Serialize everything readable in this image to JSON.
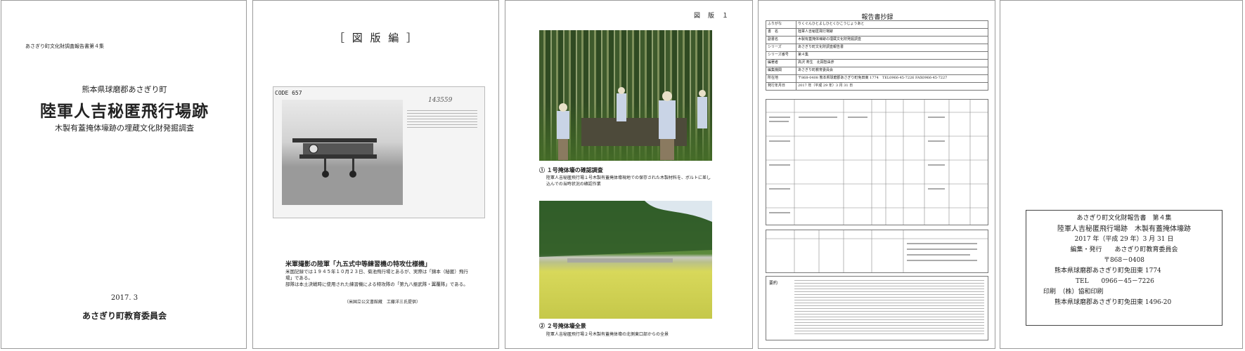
{
  "page1": {
    "series": "あさぎり町文化財調査報告書第４集",
    "location": "熊本県球磨郡あさぎり町",
    "title": "陸軍人吉秘匿飛行場跡",
    "subtitle": "木製有蓋掩体壕跡の埋蔵文化財発掘調査",
    "date": "2017. 3",
    "publisher": "あさぎり町教育委員会"
  },
  "page2": {
    "heading": "［ 図 版 編 ］",
    "photo_code": "CODE 657",
    "photo_stamp": "143559",
    "caption_title": "米軍撮影の陸軍「九五式中等練習機の特攻仕様機」",
    "caption_body": "米国記録では１９４５年１０月２３日、菊池飛行場とあるが、実際は「錦本（秘匿）飛行場」である。",
    "caption_body2": "部隊は本土決戦時に使用された練習機による特攻隊の「第九八振武隊・翼覆隊」である。",
    "source": "（米国立公文書館蔵　工藤洋三氏提供）"
  },
  "page3": {
    "plate": "図　版　１",
    "caption1_title": "① １号掩体壕の確認調査",
    "caption1_body": "陸軍人吉秘匿飛行場１号木製有蓋掩体壕現地での保存された木製材料を、ボルトに差し込んでの当時状況の確認作業",
    "caption2_title": "② ２号掩体壕全景",
    "caption2_body": "陸軍人吉秘匿飛行場２号木製有蓋掩体壕の北側東口部からの全景"
  },
  "page4": {
    "title": "報告書抄録",
    "rows": [
      {
        "label": "ふりがな",
        "value": "りくぐんひとよしひとくひこうじょうあと"
      },
      {
        "label": "書　名",
        "value": "陸軍人吉秘匿飛行場跡"
      },
      {
        "label": "副書名",
        "value": "木製有蓋掩体壕跡の埋蔵文化財発掘調査"
      },
      {
        "label": "シリーズ",
        "value": "あさぎり町文化財調査報告書"
      },
      {
        "label": "シリーズ番号",
        "value": "第４集"
      },
      {
        "label": "編著者",
        "value": "高沢 寿生　北岡智由彦"
      },
      {
        "label": "編集機関",
        "value": "あさぎり町教育委員会"
      },
      {
        "label": "所在地",
        "value": "〒868-0408 熊本県球磨郡あさぎり町免田東 1774　TEL0966-45-7226 FAX0966-45-7227"
      },
      {
        "label": "発行年月日",
        "value": "2017 年（平成 29 年）3 月 31 日"
      }
    ],
    "summary_label": "要約"
  },
  "page5": {
    "line1": "あさぎり町文化財報告書　第４集",
    "line2": "陸軍人吉秘匿飛行場跡　木製有蓋掩体壕跡",
    "line3": "2017 年（平成 29 年）3 月 31 日",
    "line4": "編集・発行　　あさぎり町教育委員会",
    "line5": "〒868－0408",
    "line6": "熊本県球磨郡あさぎり町免田東 1774",
    "line7": "TEL　　0966－45－7226",
    "line8": "印刷　（株）協和印刷",
    "line9": "熊本県球磨郡あさぎり町免田東 1496-20"
  }
}
